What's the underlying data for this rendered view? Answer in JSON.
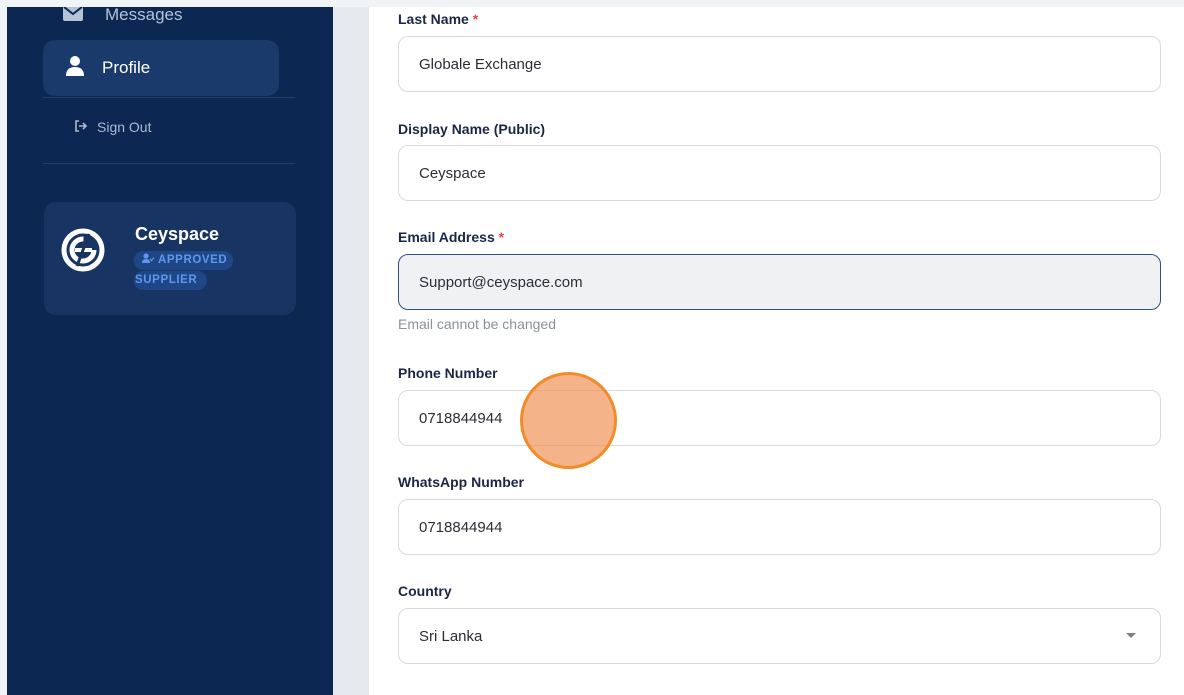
{
  "sidebar": {
    "nav": {
      "messages": "Messages",
      "profile": "Profile",
      "sign_out": "Sign Out"
    },
    "profile_card": {
      "name": "Ceyspace",
      "badge_line1": "APPROVED",
      "badge_line2": "SUPPLIER"
    }
  },
  "form": {
    "last_name": {
      "label": "Last Name",
      "required": "*",
      "value": "Globale Exchange"
    },
    "display_name": {
      "label": "Display Name (Public)",
      "value": "Ceyspace"
    },
    "email": {
      "label": "Email Address",
      "required": "*",
      "value": "Support@ceyspace.com",
      "hint": "Email cannot be changed"
    },
    "phone": {
      "label": "Phone Number",
      "value": "0718844944"
    },
    "whatsapp": {
      "label": "WhatsApp Number",
      "value": "0718844944"
    },
    "country": {
      "label": "Country",
      "value": "Sri Lanka"
    }
  },
  "icons": {
    "messages": "envelope-icon",
    "profile": "user-icon",
    "sign_out": "sign-out-icon",
    "badge": "user-check-icon",
    "logo": "ceyspace-logo",
    "select": "caret-down-icon"
  },
  "colors": {
    "sidebar_bg": "#0b2752",
    "active_nav_bg": "#1b3a6c",
    "badge_text": "#5e97f0",
    "required": "#e5484d",
    "click_indicator": "#f28c28"
  }
}
